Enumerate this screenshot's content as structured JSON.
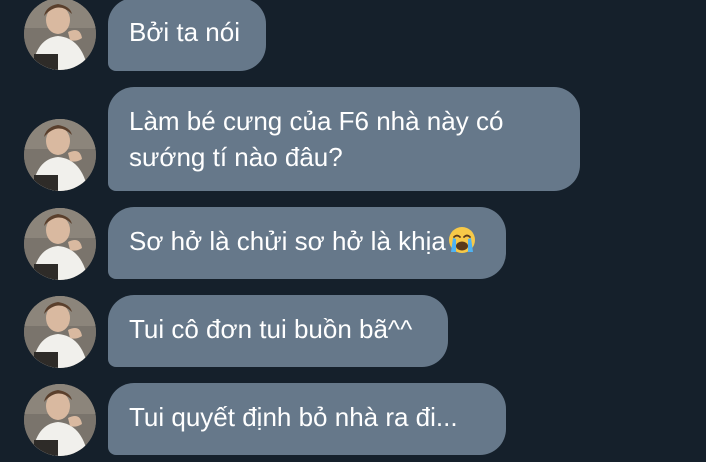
{
  "messages": [
    {
      "text": "Bởi ta nói"
    },
    {
      "lines": [
        "Làm bé cưng của F6 nhà này có",
        "sướng tí nào đâu?"
      ]
    },
    {
      "text": "Sơ hở là chửi sơ hở là khịa",
      "emoji": "loudly-crying-face-emoji"
    },
    {
      "text": "Tui cô đơn tui buồn bã^^"
    },
    {
      "text": "Tui quyết định bỏ nhà ra đi..."
    }
  ],
  "colors": {
    "background": "#15202b",
    "bubble": "#66788a",
    "text": "#ffffff"
  },
  "avatar": {
    "icon": "user-avatar-photo"
  }
}
